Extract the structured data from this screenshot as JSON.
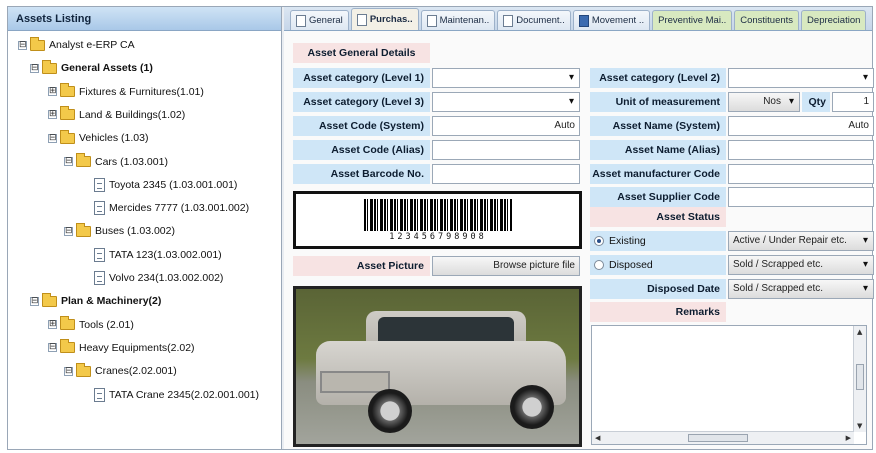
{
  "left_panel": {
    "title": "Assets Listing",
    "tree": [
      {
        "label": "Analyst e-ERP CA",
        "toggle": "⊟",
        "bold": false,
        "icon": "folder-open-icon"
      },
      {
        "label": "General Assets (1)",
        "toggle": "⊟",
        "bold": true,
        "icon": "folder-icon"
      },
      {
        "label": "Fixtures & Furnitures(1.01)",
        "toggle": "⊞",
        "bold": false,
        "icon": "folder-icon"
      },
      {
        "label": "Land & Buildings(1.02)",
        "toggle": "⊞",
        "bold": false,
        "icon": "folder-icon"
      },
      {
        "label": "Vehicles (1.03)",
        "toggle": "⊟",
        "bold": false,
        "icon": "folder-icon"
      },
      {
        "label": "Cars (1.03.001)",
        "toggle": "⊟",
        "bold": false,
        "icon": "folder-icon"
      },
      {
        "label": "Toyota 2345 (1.03.001.001)",
        "toggle": "",
        "bold": false,
        "icon": "document-icon"
      },
      {
        "label": "Mercides 7777 (1.03.001.002)",
        "toggle": "",
        "bold": false,
        "icon": "document-icon"
      },
      {
        "label": "Buses (1.03.002)",
        "toggle": "⊟",
        "bold": false,
        "icon": "folder-icon"
      },
      {
        "label": "TATA 123(1.03.002.001)",
        "toggle": "",
        "bold": false,
        "icon": "document-icon"
      },
      {
        "label": "Volvo 234(1.03.002.002)",
        "toggle": "",
        "bold": false,
        "icon": "document-icon"
      },
      {
        "label": "Plan & Machinery(2)",
        "toggle": "⊟",
        "bold": true,
        "icon": "folder-icon"
      },
      {
        "label": "Tools (2.01)",
        "toggle": "⊞",
        "bold": false,
        "icon": "folder-icon"
      },
      {
        "label": "Heavy Equipments(2.02)",
        "toggle": "⊟",
        "bold": false,
        "icon": "folder-icon"
      },
      {
        "label": "Cranes(2.02.001)",
        "toggle": "⊟",
        "bold": false,
        "icon": "folder-icon"
      },
      {
        "label": "TATA Crane 2345(2.02.001.001)",
        "toggle": "",
        "bold": false,
        "icon": "document-icon"
      }
    ]
  },
  "tabs": [
    {
      "label": "General",
      "icon": "document-icon",
      "active": false
    },
    {
      "label": "Purchas..",
      "icon": "document-icon",
      "active": true
    },
    {
      "label": "Maintenan..",
      "icon": "document-icon",
      "active": false
    },
    {
      "label": "Document..",
      "icon": "document-icon",
      "active": false
    },
    {
      "label": "Movement ..",
      "icon": "save-icon",
      "active": false
    },
    {
      "label": "Preventive Mai..",
      "icon": "",
      "active": false
    },
    {
      "label": "Constituents",
      "icon": "",
      "active": false
    },
    {
      "label": "Depreciation",
      "icon": "",
      "active": false
    }
  ],
  "form": {
    "section_title": "Asset General Details",
    "cat1_label": "Asset category (Level 1)",
    "cat1_value": "",
    "cat2_label": "Asset category (Level 2)",
    "cat2_value": "",
    "cat3_label": "Asset category (Level 3)",
    "cat3_value": "",
    "uom_label": "Unit of measurement",
    "uom_value": "Nos",
    "qty_label": "Qty",
    "qty_value": "1",
    "code_system_label": "Asset Code (System)",
    "code_system_value": "Auto",
    "name_system_label": "Asset Name (System)",
    "name_system_value": "Auto",
    "code_alias_label": "Asset Code (Alias)",
    "code_alias_value": "",
    "name_alias_label": "Asset Name (Alias)",
    "name_alias_value": "",
    "barcode_label": "Asset Barcode No.",
    "barcode_value": "",
    "manufacturer_label": "Asset manufacturer Code",
    "manufacturer_value": "",
    "supplier_label": "Asset Supplier Code",
    "supplier_value": "",
    "status_label": "Asset Status",
    "existing_label": "Existing",
    "existing_value": "Active / Under Repair etc.",
    "disposed_label": "Disposed",
    "disposed_value": "Sold / Scrapped etc.",
    "disposed_date_label": "Disposed Date",
    "disposed_date_value": "Sold / Scrapped etc.",
    "remarks_label": "Remarks",
    "remarks_value": "",
    "picture_label": "Asset Picture",
    "browse_label": "Browse picture file",
    "barcode_digits": "123456798908"
  },
  "colors": {
    "label_blue": "#cfe6f7",
    "label_pink": "#f7e3e3",
    "header_blue": "#a9c8e8"
  }
}
